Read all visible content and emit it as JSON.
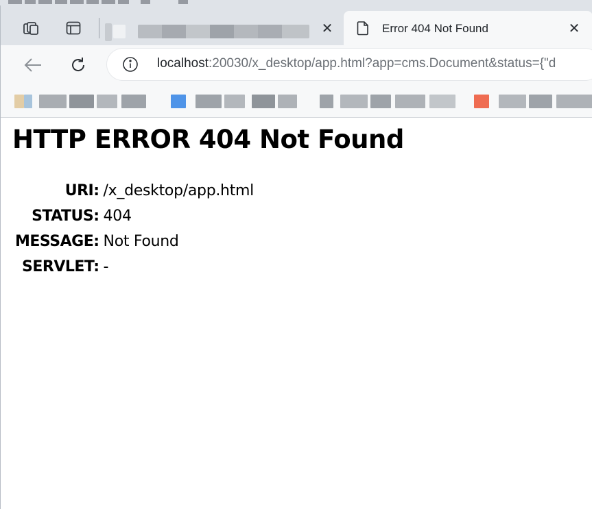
{
  "browser": {
    "tabs": [
      {
        "title": "",
        "active": false
      },
      {
        "title": "Error 404 Not Found",
        "active": true
      }
    ],
    "address": {
      "host": "localhost",
      "rest": ":20030/x_desktop/app.html?app=cms.Document&status={\"d"
    }
  },
  "page": {
    "heading": "HTTP ERROR 404 Not Found",
    "rows": [
      {
        "label": "URI:",
        "value": "/x_desktop/app.html"
      },
      {
        "label": "STATUS:",
        "value": "404"
      },
      {
        "label": "MESSAGE:",
        "value": "Not Found"
      },
      {
        "label": "SERVLET:",
        "value": "-"
      }
    ]
  },
  "icons": {
    "workspaces": "workspaces-icon",
    "tab_actions": "tab-actions-icon",
    "page": "page-icon",
    "back": "back-arrow-icon",
    "refresh": "refresh-icon",
    "site_info": "info-icon",
    "close": "close-icon"
  },
  "colors": {
    "tab_strip": "#dfe3e8",
    "toolbar": "#f7f8f9",
    "text": "#000000"
  }
}
